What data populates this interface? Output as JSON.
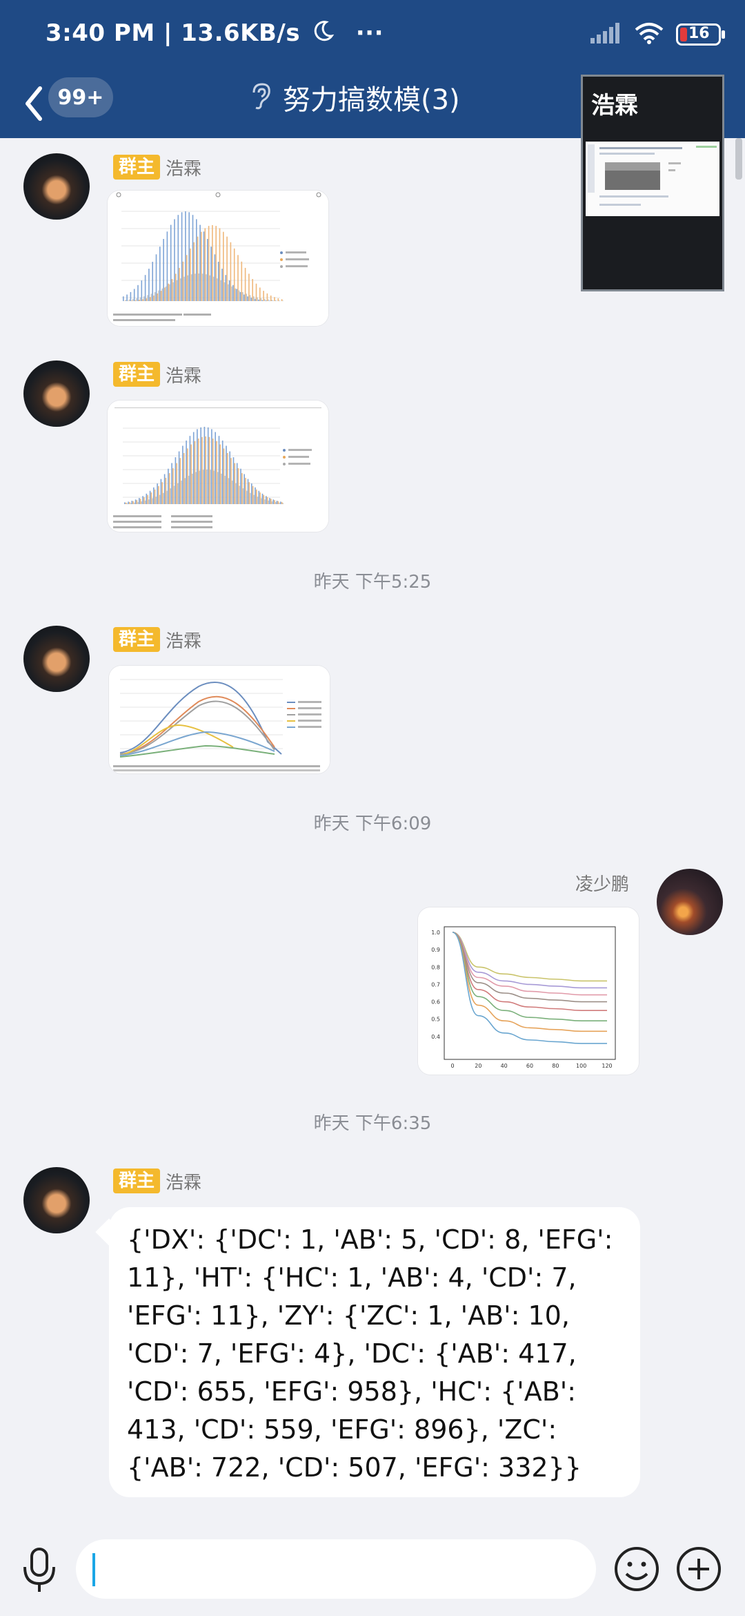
{
  "status": {
    "time_speed": "3:40 PM | 13.6KB/s",
    "dots": "···",
    "battery": "16"
  },
  "header": {
    "unread_badge": "99+",
    "title": "努力搞数模(3)"
  },
  "pip": {
    "name": "浩霖"
  },
  "messages": [
    {
      "type": "image",
      "role_badge": "群主",
      "sender": "浩霖"
    },
    {
      "type": "image",
      "role_badge": "群主",
      "sender": "浩霖"
    },
    {
      "type": "time",
      "text": "昨天 下午5:25"
    },
    {
      "type": "image",
      "role_badge": "群主",
      "sender": "浩霖"
    },
    {
      "type": "time",
      "text": "昨天 下午6:09"
    },
    {
      "type": "image",
      "sender": "凌少鹏",
      "outgoing": true
    },
    {
      "type": "time",
      "text": "昨天 下午6:35"
    },
    {
      "type": "text",
      "role_badge": "群主",
      "sender": "浩霖",
      "text": "{'DX': {'DC': 1, 'AB': 5, 'CD': 8, 'EFG': 11}, 'HT': {'HC': 1, 'AB': 4, 'CD': 7, 'EFG': 11}, 'ZY': {'ZC': 1, 'AB': 10, 'CD': 7, 'EFG': 4}, 'DC': {'AB': 417, 'CD': 655, 'EFG': 958}, 'HC': {'AB': 413, 'CD': 559, 'EFG': 896}, 'ZC': {'AB': 722, 'CD': 507, 'EFG': 332}}"
    }
  ],
  "chart_data": [
    {
      "type": "line",
      "x": [
        0,
        20,
        40,
        60,
        80,
        100,
        120
      ],
      "ylim": [
        0.3,
        1.0
      ],
      "xlim": [
        0,
        120
      ],
      "y_ticks": [
        "1.0",
        "0.9",
        "0.8",
        "0.7",
        "0.6",
        "0.5",
        "0.4"
      ],
      "x_ticks": [
        "0",
        "20",
        "40",
        "60",
        "80",
        "100",
        "120"
      ],
      "series": [
        {
          "color": "#c9c36a",
          "values": [
            1.0,
            0.8,
            0.76,
            0.74,
            0.73,
            0.72,
            0.72
          ]
        },
        {
          "color": "#a79ad6",
          "values": [
            1.0,
            0.77,
            0.72,
            0.7,
            0.69,
            0.68,
            0.68
          ]
        },
        {
          "color": "#e19aa9",
          "values": [
            1.0,
            0.74,
            0.69,
            0.66,
            0.65,
            0.64,
            0.64
          ]
        },
        {
          "color": "#9c8f88",
          "values": [
            1.0,
            0.71,
            0.65,
            0.62,
            0.61,
            0.6,
            0.6
          ]
        },
        {
          "color": "#d07a7a",
          "values": [
            1.0,
            0.67,
            0.6,
            0.57,
            0.56,
            0.55,
            0.55
          ]
        },
        {
          "color": "#7ab07a",
          "values": [
            1.0,
            0.63,
            0.55,
            0.51,
            0.5,
            0.49,
            0.49
          ]
        },
        {
          "color": "#e6a35a",
          "values": [
            1.0,
            0.58,
            0.49,
            0.45,
            0.44,
            0.43,
            0.43
          ]
        },
        {
          "color": "#6aa6d0",
          "values": [
            1.0,
            0.52,
            0.42,
            0.38,
            0.37,
            0.36,
            0.36
          ]
        }
      ]
    }
  ],
  "input": {
    "placeholder": ""
  }
}
